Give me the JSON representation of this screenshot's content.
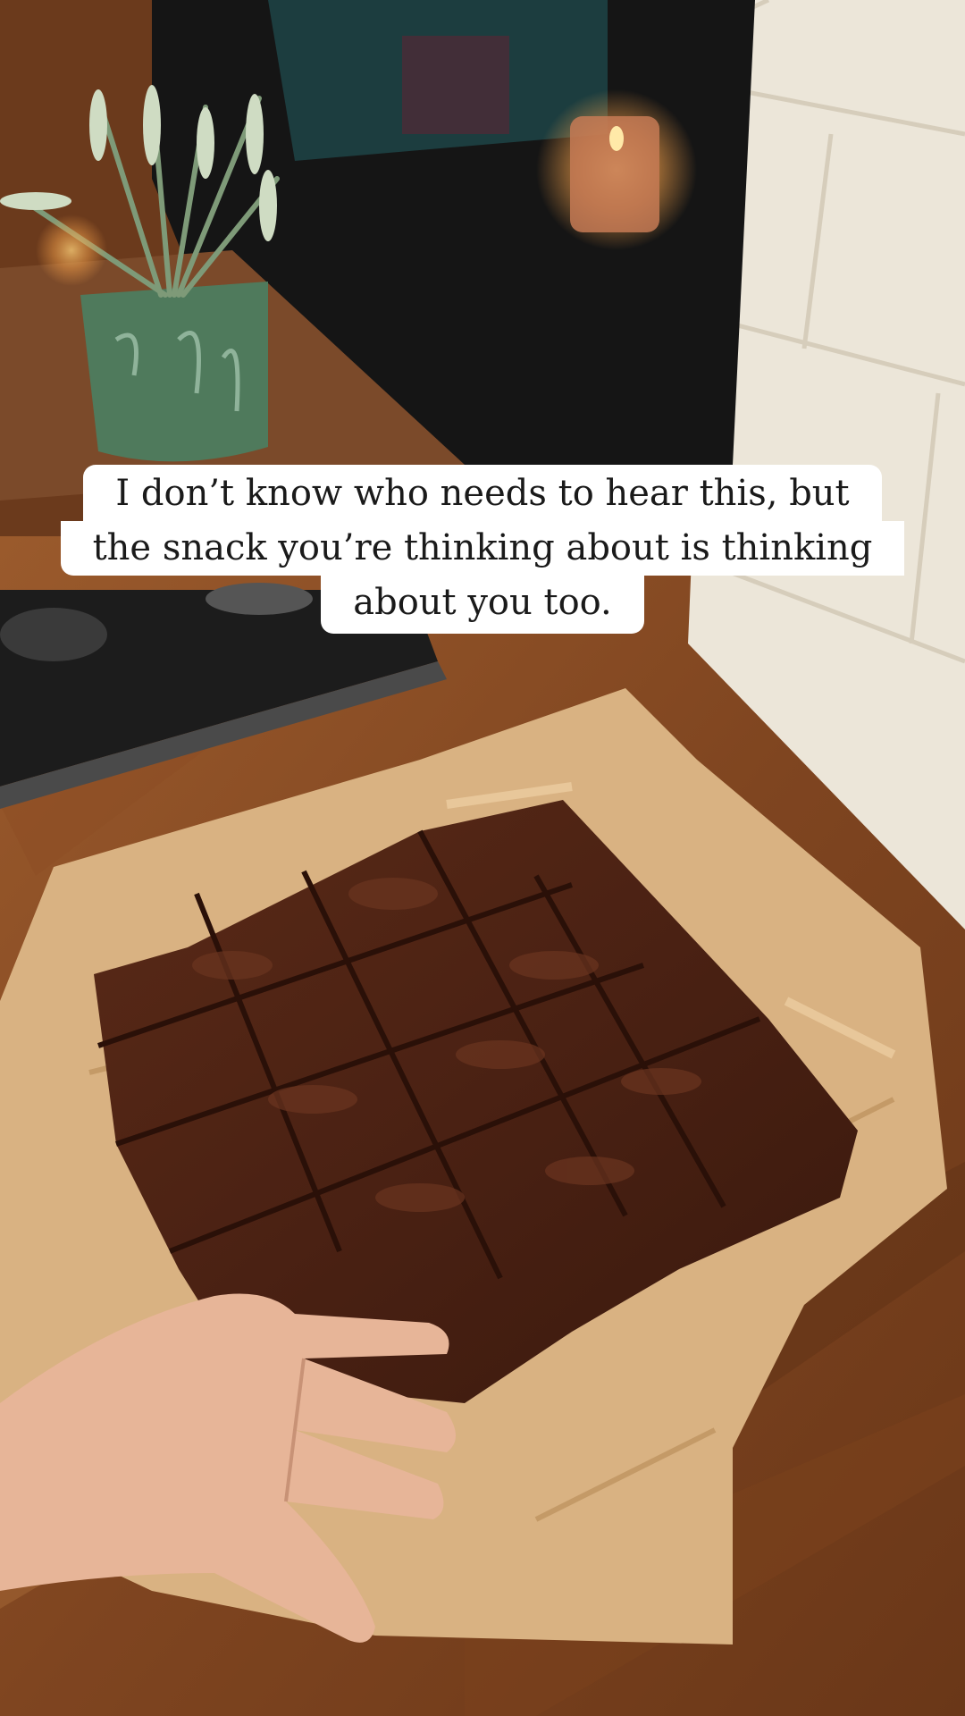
{
  "caption": {
    "lines": [
      "I don’t know who needs to hear this, but",
      "the snack you’re thinking about is thinking",
      "about you too."
    ]
  },
  "scene": {
    "subjects": [
      "brownie-tray",
      "parchment-paper",
      "hand",
      "potted-plant",
      "candle",
      "oven",
      "hob",
      "wall-tiles",
      "wooden-worktop"
    ],
    "colors": {
      "worktop": "#8a4e25",
      "brownie": "#4a2113",
      "parchment": "#d9b282",
      "tiles": "#ece6d9",
      "oven": "#151515",
      "pot": "#4f7a5c",
      "candle_glow": "#f6a24a",
      "skin": "#e7b598"
    }
  }
}
